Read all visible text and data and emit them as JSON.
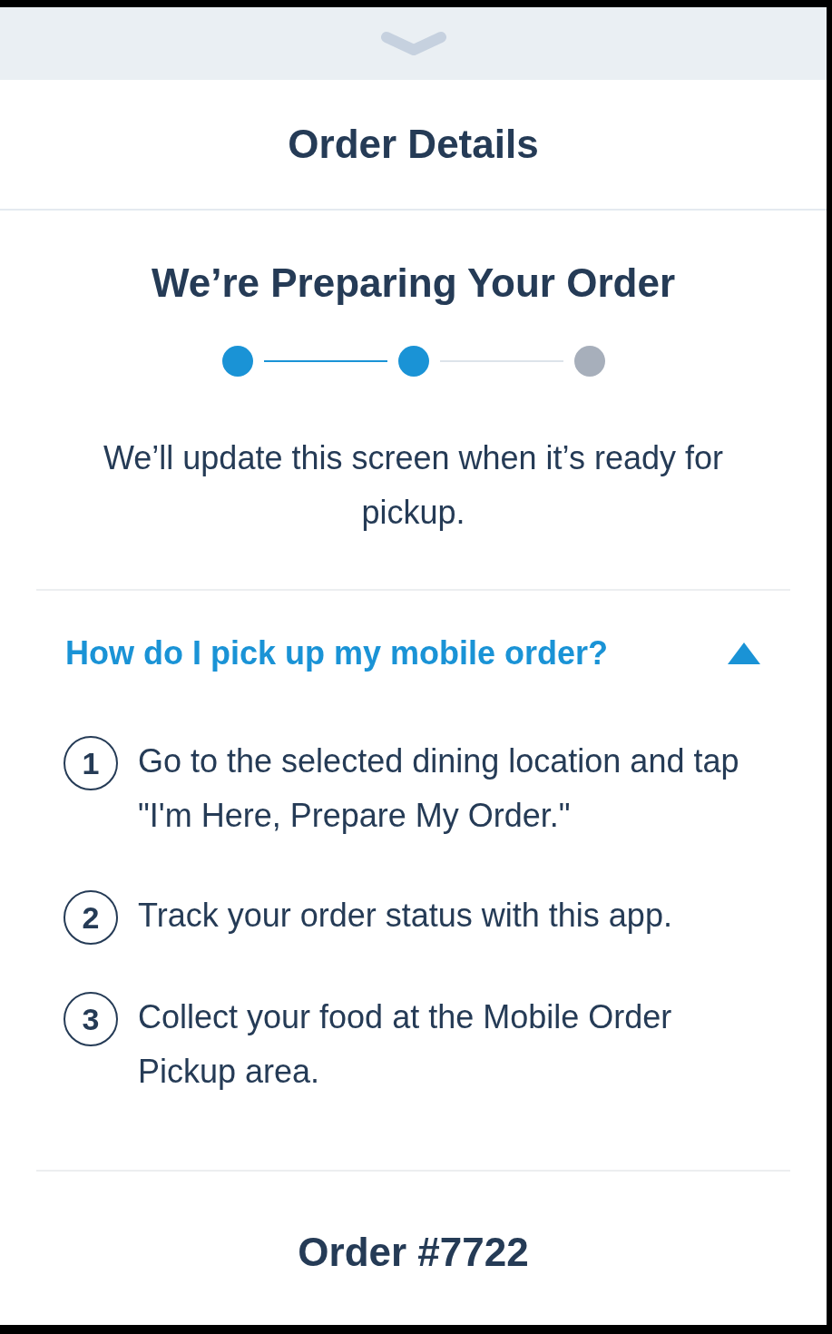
{
  "header": {
    "title": "Order Details"
  },
  "status": {
    "heading": "We’re Preparing Your Order",
    "steps": [
      {
        "done": true
      },
      {
        "done": true
      },
      {
        "done": false
      }
    ],
    "message": "We’ll update this screen when it’s ready for pickup."
  },
  "faq": {
    "question": "How do I pick up my mobile order?",
    "expanded": true,
    "steps": [
      {
        "number": "1",
        "text": "Go to the selected dining location and tap \"I'm Here, Prepare My Order.\""
      },
      {
        "number": "2",
        "text": "Track your order status with this app."
      },
      {
        "number": "3",
        "text": "Collect your food at the Mobile Order Pickup area."
      }
    ]
  },
  "order": {
    "title": "Order #7722"
  }
}
